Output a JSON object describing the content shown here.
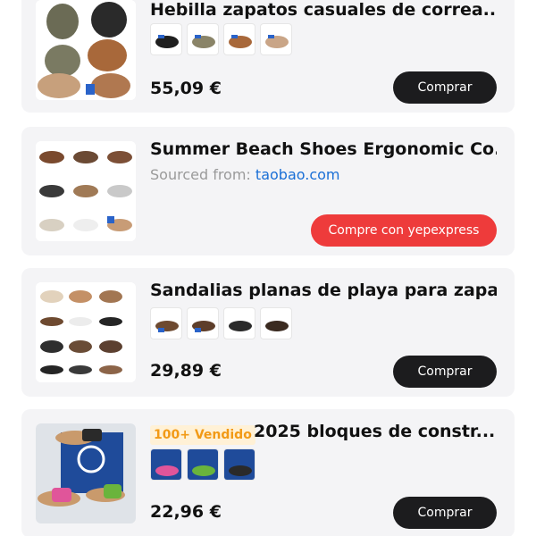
{
  "products": [
    {
      "title": "Hebilla zapatos casuales de correa...",
      "price": "55,09 €",
      "button": "Comprar",
      "variant_count": 4
    },
    {
      "title": "Summer Beach Shoes Ergonomic Co...",
      "sourced_label": "Sourced from:",
      "sourced_link": "taobao.com",
      "button": "Compre con yepexpress"
    },
    {
      "title": "Sandalias planas de playa para zapa...",
      "price": "29,89 €",
      "button": "Comprar",
      "variant_count": 4
    },
    {
      "badge": "100+ Vendido",
      "title": "2025 bloques de constr...",
      "price": "22,96 €",
      "button": "Comprar",
      "variant_count": 3
    }
  ],
  "colors": {
    "card_bg": "#f4f4f6",
    "dark_button": "#1c1c1e",
    "red_button": "#ee3b3b",
    "link": "#1a6fd6",
    "badge_text": "#f29a16",
    "badge_bg": "#fff1d6"
  }
}
